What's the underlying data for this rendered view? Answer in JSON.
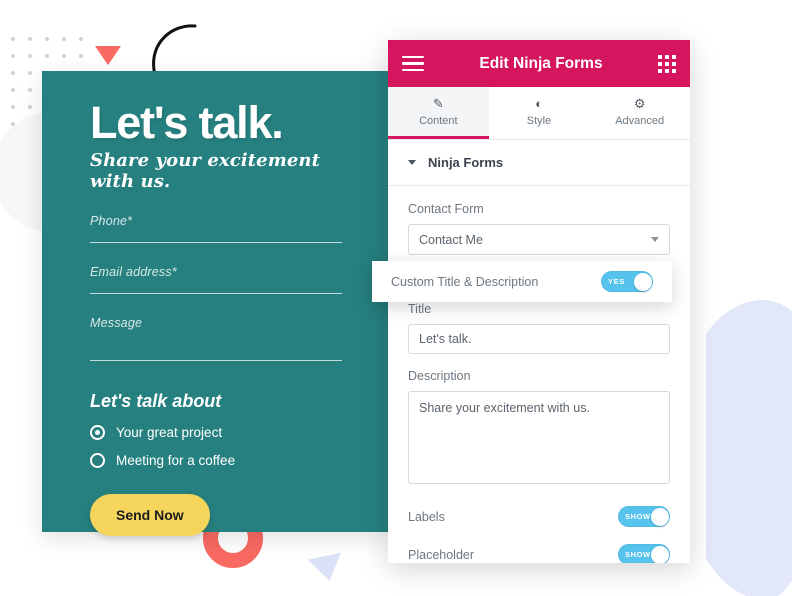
{
  "colors": {
    "teal": "#26807F",
    "pink": "#D6155F",
    "yellow": "#F6D55C",
    "toggle_blue": "#55C3EC",
    "coral": "#F96A62",
    "lavender": "#E2E8FA"
  },
  "form_preview": {
    "heading": "Let's talk.",
    "subheading": "Share your excitement with us.",
    "fields": [
      {
        "label": "Phone*",
        "tall": false
      },
      {
        "label": "Email address*",
        "tall": false
      },
      {
        "label": "Message",
        "tall": true
      }
    ],
    "radio_group_heading": "Let's talk about",
    "radio_options": [
      {
        "label": "Your great project",
        "selected": true
      },
      {
        "label": "Meeting for a coffee",
        "selected": false
      }
    ],
    "submit_label": "Send Now"
  },
  "editor": {
    "header": {
      "title": "Edit Ninja Forms",
      "menu_icon": "hamburger-icon",
      "apps_icon": "apps-grid-icon"
    },
    "tabs": [
      {
        "label": "Content",
        "icon": "pencil-icon",
        "glyph": "✎",
        "active": true
      },
      {
        "label": "Style",
        "icon": "contrast-icon",
        "glyph": "◐",
        "active": false
      },
      {
        "label": "Advanced",
        "icon": "gear-icon",
        "glyph": "⚙",
        "active": false
      }
    ],
    "section": {
      "title": "Ninja Forms",
      "caret_icon": "caret-down-icon"
    },
    "controls": {
      "contact_form_label": "Contact Form",
      "contact_form_value": "Contact Me",
      "contact_form_options": [
        "Contact Me"
      ],
      "custom_title_label": "Custom Title & Description",
      "custom_title_toggle": "YES",
      "title_label": "Title",
      "title_value": "Let's talk.",
      "title_placeholder": "Title",
      "description_label": "Description",
      "description_value": "Share your excitement with us.",
      "description_placeholder": "Description",
      "labels_label": "Labels",
      "labels_toggle": "SHOW",
      "placeholder_label": "Placeholder",
      "placeholder_toggle": "SHOW"
    }
  }
}
